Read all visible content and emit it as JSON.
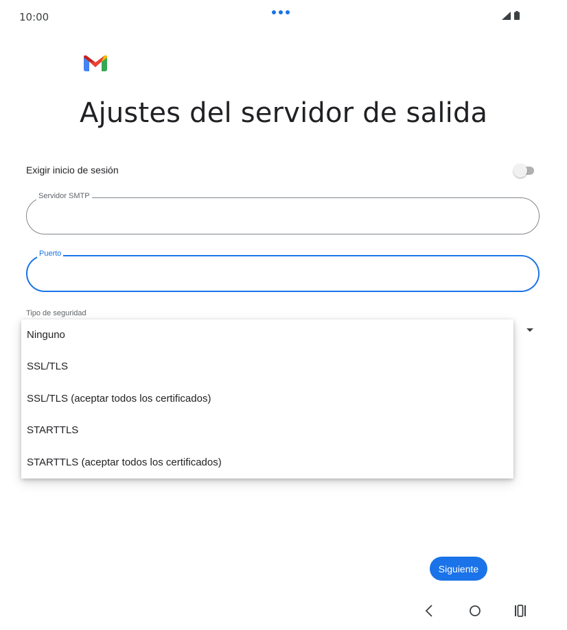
{
  "status_bar": {
    "time": "10:00"
  },
  "header": {
    "title": "Ajustes del servidor de salida"
  },
  "login_toggle": {
    "label": "Exigir inicio de sesión",
    "enabled": false
  },
  "smtp_field": {
    "label": "Servidor SMTP",
    "value": ""
  },
  "port_field": {
    "label": "Puerto",
    "value": ""
  },
  "security": {
    "label": "Tipo de seguridad",
    "options": [
      "Ninguno",
      "SSL/TLS",
      "SSL/TLS (aceptar todos los certificados)",
      "STARTTLS",
      "STARTTLS (aceptar todos los certificados)"
    ]
  },
  "footer": {
    "next_label": "Siguiente"
  },
  "colors": {
    "accent": "#1a73e8",
    "gmail_red": "#ea4335",
    "gmail_blue": "#4285f4",
    "gmail_green": "#34a853",
    "gmail_yellow": "#fbbc04"
  },
  "icons": {
    "logo": "gmail-logo",
    "signal": "signal-icon",
    "battery": "battery-icon",
    "dropdown": "dropdown-arrow-icon",
    "back": "back-icon",
    "home": "home-icon",
    "recents": "recents-icon"
  }
}
